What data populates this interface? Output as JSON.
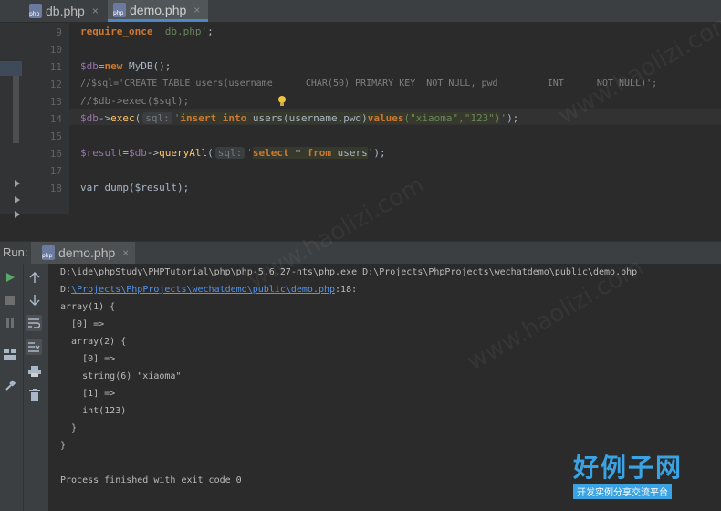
{
  "editor_tabs": [
    {
      "label": "db.php",
      "close": "×"
    },
    {
      "label": "demo.php",
      "close": "×"
    }
  ],
  "editor": {
    "line_numbers": [
      "9",
      "10",
      "11",
      "12",
      "13",
      "14",
      "15",
      "16",
      "17",
      "18"
    ],
    "line9": {
      "kw": "require_once",
      "str": "'db.php'",
      "end": ";"
    },
    "line11": {
      "var": "$db",
      "op": "=",
      "kw": "new",
      "rest": " MyDB();"
    },
    "line12": "//$sql='CREATE TABLE users(username      CHAR(50) PRIMARY KEY  NOT NULL, pwd         INT      NOT NULL)';",
    "line13": "//$db->exec($sql);",
    "line14": {
      "var": "$db",
      "arrow": "->",
      "fn": "exec",
      "open": "(",
      "hint": "sql:",
      "q1": "'",
      "kw1": "insert",
      "kw2": "into",
      "rest": "users(username,pwd)",
      "kw3": "values",
      "vals": "(\"xiaoma\",\"123\")",
      "q2": "'",
      "end": ");"
    },
    "line16": {
      "var1": "$result",
      "op": "=",
      "var2": "$db",
      "arrow": "->",
      "fn": "queryAll",
      "open": "(",
      "hint": "sql:",
      "q1": "'",
      "kw1": "select",
      "star": "*",
      "kw2": "from",
      "rest": "users",
      "q2": "'",
      "end": ");"
    },
    "line18": "var_dump($result);"
  },
  "run": {
    "label": "Run:",
    "tab_label": "demo.php",
    "tab_close": "×",
    "toolbar_icons": [
      "run-icon",
      "stop-icon",
      "pause-icon",
      "layout-icon",
      "pin-icon",
      "up-arrow-icon",
      "down-arrow-icon",
      "soft-wrap-icon",
      "scroll-to-end-icon",
      "print-icon",
      "trash-icon"
    ]
  },
  "console": {
    "cmd": "D:\\ide\\phpStudy\\PHPTutorial\\php\\php-5.6.27-nts\\php.exe D:\\Projects\\PhpProjects\\wechatdemo\\public\\demo.php",
    "path_prefix": "D:",
    "path_link": "\\Projects\\PhpProjects\\wechatdemo\\public\\demo.php",
    "path_suffix": ":18:",
    "out1": "array(1) {",
    "out2": "  [0] =>",
    "out3": "  array(2) {",
    "out4": "    [0] =>",
    "out5": "    string(6) \"xiaoma\"",
    "out6": "    [1] =>",
    "out7": "    int(123)",
    "out8": "  }",
    "out9": "}",
    "finish": "Process finished with exit code 0"
  },
  "watermark": {
    "text": "www.haolizi.com",
    "logo_big": "好例子网",
    "logo_small": "开发实例分享交流平台"
  }
}
